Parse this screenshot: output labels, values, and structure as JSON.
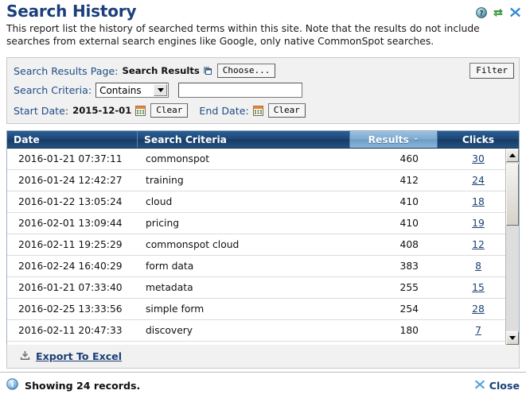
{
  "header": {
    "title": "Search History",
    "description": "This report list the history of searched terms within this site. Note that the results do not include searches from external search engines like Google, only native CommonSpot searches.",
    "icons": [
      {
        "name": "help-icon",
        "glyph": "?"
      },
      {
        "name": "refresh-icon",
        "glyph": "refresh"
      },
      {
        "name": "close-icon",
        "glyph": "x"
      }
    ]
  },
  "filter": {
    "results_page_label": "Search Results Page:",
    "results_page_value": "Search Results",
    "choose_button": "Choose...",
    "criteria_label": "Search Criteria:",
    "criteria_operator": "Contains",
    "criteria_operator_options": [
      "Contains"
    ],
    "criteria_value": "",
    "criteria_placeholder": "",
    "start_date_label": "Start Date:",
    "start_date_value": "2015-12-01",
    "start_date_clear": "Clear",
    "end_date_label": "End Date:",
    "end_date_value": "",
    "end_date_clear": "Clear",
    "filter_button": "Filter"
  },
  "table": {
    "columns": [
      {
        "key": "date",
        "label": "Date",
        "sorted": false
      },
      {
        "key": "criteria",
        "label": "Search Criteria",
        "sorted": false
      },
      {
        "key": "results",
        "label": "Results",
        "sorted": true,
        "sort_caret": "⌄"
      },
      {
        "key": "clicks",
        "label": "Clicks",
        "sorted": false
      }
    ],
    "rows": [
      {
        "date": "2016-01-21 07:37:11",
        "criteria": "commonspot",
        "results": "460",
        "clicks": "30"
      },
      {
        "date": "2016-01-24 12:42:27",
        "criteria": "training",
        "results": "412",
        "clicks": "24"
      },
      {
        "date": "2016-01-22 13:05:24",
        "criteria": "cloud",
        "results": "410",
        "clicks": "18"
      },
      {
        "date": "2016-02-01 13:09:44",
        "criteria": "pricing",
        "results": "410",
        "clicks": "19"
      },
      {
        "date": "2016-02-11 19:25:29",
        "criteria": "commonspot cloud",
        "results": "408",
        "clicks": "12"
      },
      {
        "date": "2016-02-24 16:40:29",
        "criteria": "form data",
        "results": "383",
        "clicks": "8"
      },
      {
        "date": "2016-01-21 07:33:40",
        "criteria": "metadata",
        "results": "255",
        "clicks": "15"
      },
      {
        "date": "2016-02-25 13:33:56",
        "criteria": "simple form",
        "results": "254",
        "clicks": "28"
      },
      {
        "date": "2016-02-11 20:47:33",
        "criteria": "discovery",
        "results": "180",
        "clicks": "7"
      }
    ]
  },
  "export": {
    "label": "Export To Excel",
    "icon": "export-icon"
  },
  "status": {
    "message": "Showing 24 records.",
    "info_icon": "info-icon",
    "close_label": "Close",
    "close_icon": "close-icon"
  },
  "colors": {
    "title_blue": "#1c3f7c",
    "header_blue": "#1d4677",
    "sorted_header_blue": "#7eaacf",
    "link_blue": "#1b3f73",
    "label_blue": "#1e4c86",
    "panel_gray": "#f1f1f1"
  }
}
